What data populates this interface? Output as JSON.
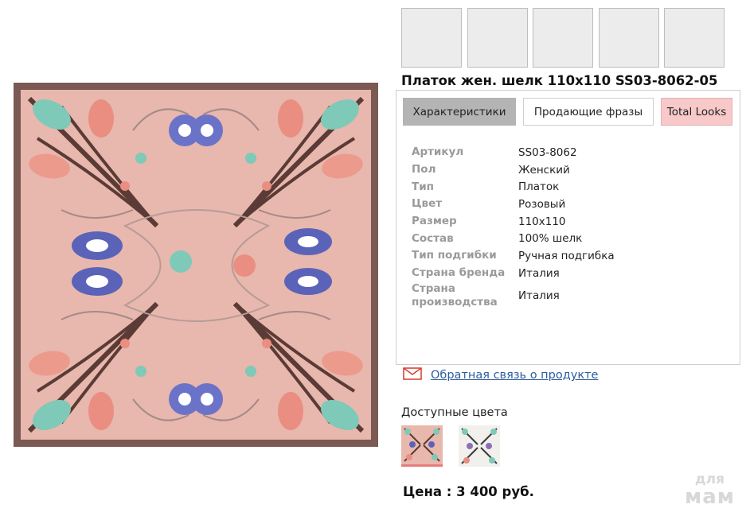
{
  "product": {
    "title": "Платок жен. шелк 110х110 SS03-8062-05",
    "image": {
      "main_color": "#e8b7ad",
      "border_color": "#7a5a52"
    }
  },
  "thumbnails": {
    "count": 5
  },
  "tabs": [
    {
      "label": "Характеристики",
      "active": true
    },
    {
      "label": "Продающие фразы",
      "active": false
    },
    {
      "label": "Total Looks",
      "active": false
    }
  ],
  "specs": [
    {
      "key": "Артикул",
      "value": "SS03-8062"
    },
    {
      "key": "Пол",
      "value": "Женский"
    },
    {
      "key": "Тип",
      "value": "Платок"
    },
    {
      "key": "Цвет",
      "value": "Розовый"
    },
    {
      "key": "Размер",
      "value": "110х110"
    },
    {
      "key": "Состав",
      "value": "100% шелк"
    },
    {
      "key": "Тип подгибки",
      "value": "Ручная подгибка"
    },
    {
      "key": "Страна бренда",
      "value": "Италия"
    },
    {
      "key": "Страна производства",
      "value": "Италия"
    }
  ],
  "feedback": {
    "icon": "mail-icon",
    "label": "Обратная связь о продукте"
  },
  "colors": {
    "label": "Доступные цвета",
    "swatches": [
      {
        "name": "pink",
        "color": "#e9b8ad",
        "selected": true
      },
      {
        "name": "white",
        "color": "#f2f0ec",
        "selected": false
      }
    ]
  },
  "price": {
    "label": "Цена : 3 400 руб."
  },
  "watermark": {
    "line1": "для",
    "line2": "мам"
  }
}
